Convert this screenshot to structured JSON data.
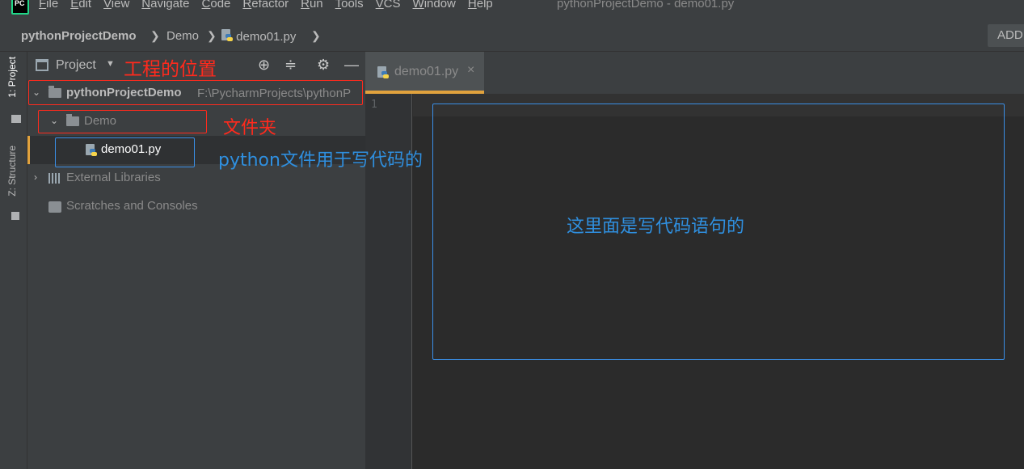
{
  "menubar": {
    "logo_text": "PC",
    "items": [
      "File",
      "Edit",
      "View",
      "Navigate",
      "Code",
      "Refactor",
      "Run",
      "Tools",
      "VCS",
      "Window",
      "Help"
    ],
    "window_title": "pythonProjectDemo - demo01.py"
  },
  "navbar": {
    "project": "pythonProjectDemo",
    "folder": "Demo",
    "file": "demo01.py",
    "separator": "❯",
    "add_button": "ADD"
  },
  "toolstrip": {
    "project_tab": "1: Project",
    "structure_tab": "Z: Structure"
  },
  "project_panel": {
    "title": "Project",
    "tree": {
      "root_name": "pythonProjectDemo",
      "root_path": "F:\\PycharmProjects\\pythonP",
      "folder": "Demo",
      "file": "demo01.py",
      "external_libraries": "External Libraries",
      "scratches": "Scratches and Consoles"
    }
  },
  "editor": {
    "tab_label": "demo01.py",
    "line_number": "1"
  },
  "annotations": {
    "project_location": "工程的位置",
    "folder": "文件夹",
    "python_file": "python文件用于写代码的",
    "code_area": "这里面是写代码语句的"
  },
  "colors": {
    "accent_orange": "#e1a23d",
    "annotation_red": "#ff2a1d",
    "annotation_blue": "#2f8fdf"
  }
}
